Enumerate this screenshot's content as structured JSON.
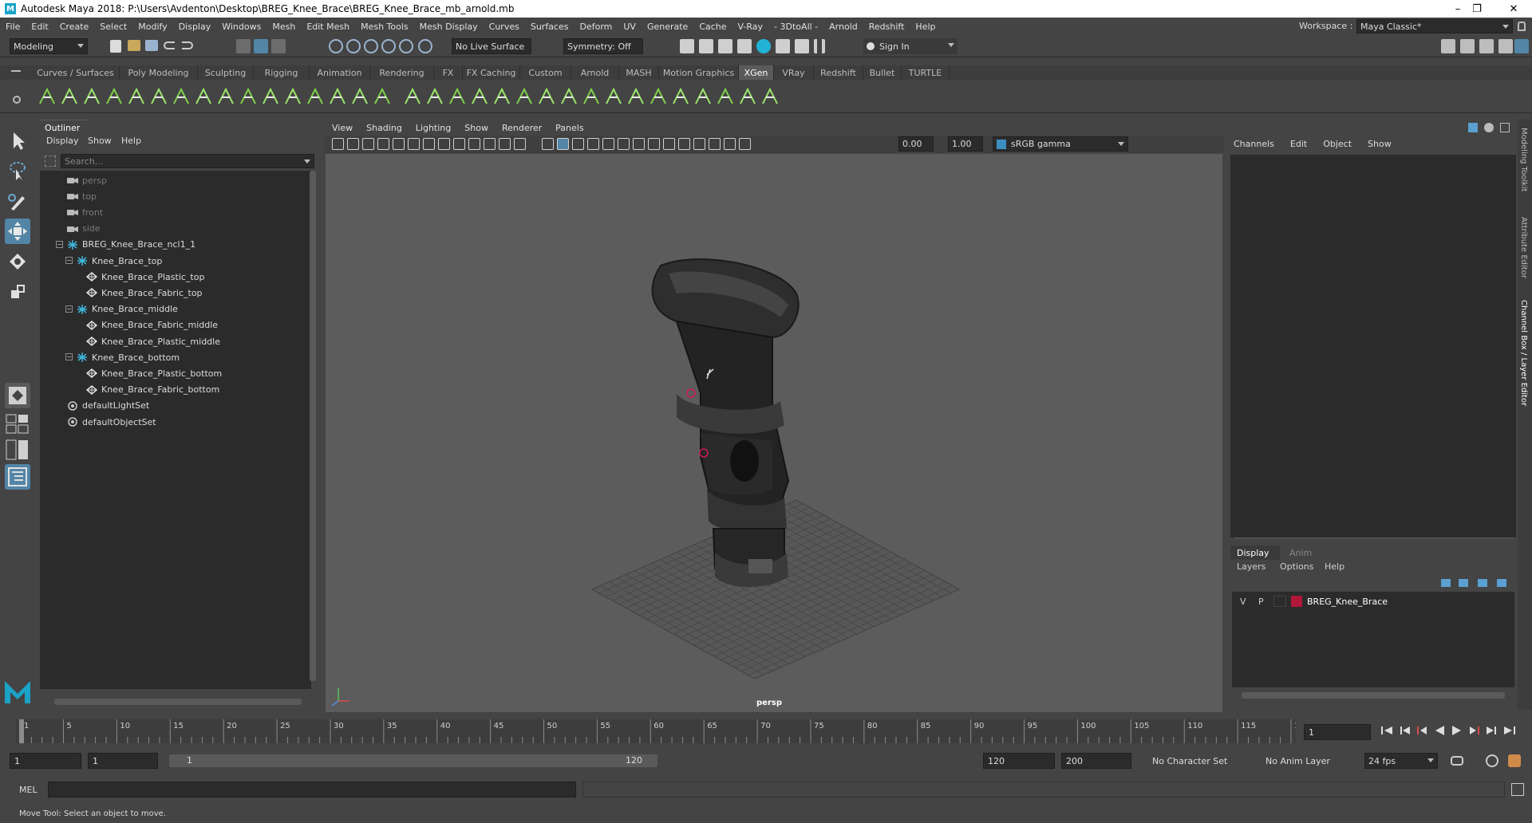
{
  "window": {
    "title": "Autodesk Maya 2018: P:\\Users\\Avdenton\\Desktop\\BREG_Knee_Brace\\BREG_Knee_Brace_mb_arnold.mb",
    "minimize": "–",
    "maximize": "❐",
    "close": "✕"
  },
  "menubar": {
    "items": [
      "File",
      "Edit",
      "Create",
      "Select",
      "Modify",
      "Display",
      "Windows",
      "Mesh",
      "Edit Mesh",
      "Mesh Tools",
      "Mesh Display",
      "Curves",
      "Surfaces",
      "Deform",
      "UV",
      "Generate",
      "Cache",
      "V-Ray",
      "- 3DtoAll -",
      "Arnold",
      "Redshift",
      "Help"
    ],
    "workspace_label": "Workspace :",
    "workspace_value": "Maya Classic*"
  },
  "statusline": {
    "mode": "Modeling",
    "live_surface": "No Live Surface",
    "symmetry": "Symmetry: Off",
    "sign_in": "Sign In"
  },
  "shelf": {
    "tabs": [
      "Curves / Surfaces",
      "Poly Modeling",
      "Sculpting",
      "Rigging",
      "Animation",
      "Rendering",
      "FX",
      "FX Caching",
      "Custom",
      "Arnold",
      "MASH",
      "Motion Graphics",
      "XGen",
      "VRay",
      "Redshift",
      "Bullet",
      "TURTLE"
    ],
    "active_tab": "XGen"
  },
  "outliner": {
    "title": "Outliner",
    "menu": [
      "Display",
      "Show",
      "Help"
    ],
    "search_placeholder": "Search...",
    "rows": [
      {
        "label": "persp",
        "indent": 0,
        "icon": "camera-icon",
        "dim": true
      },
      {
        "label": "top",
        "indent": 0,
        "icon": "camera-icon",
        "dim": true
      },
      {
        "label": "front",
        "indent": 0,
        "icon": "camera-icon",
        "dim": true
      },
      {
        "label": "side",
        "indent": 0,
        "icon": "camera-icon",
        "dim": true
      },
      {
        "label": "BREG_Knee_Brace_ncl1_1",
        "indent": 0,
        "icon": "group-icon",
        "expander": "−"
      },
      {
        "label": "Knee_Brace_top",
        "indent": 1,
        "icon": "group-icon",
        "expander": "−"
      },
      {
        "label": "Knee_Brace_Plastic_top",
        "indent": 2,
        "icon": "mesh-icon"
      },
      {
        "label": "Knee_Brace_Fabric_top",
        "indent": 2,
        "icon": "mesh-icon"
      },
      {
        "label": "Knee_Brace_middle",
        "indent": 1,
        "icon": "group-icon",
        "expander": "−"
      },
      {
        "label": "Knee_Brace_Fabric_middle",
        "indent": 2,
        "icon": "mesh-icon"
      },
      {
        "label": "Knee_Brace_Plastic_middle",
        "indent": 2,
        "icon": "mesh-icon"
      },
      {
        "label": "Knee_Brace_bottom",
        "indent": 1,
        "icon": "group-icon",
        "expander": "−"
      },
      {
        "label": "Knee_Brace_Plastic_bottom",
        "indent": 2,
        "icon": "mesh-icon"
      },
      {
        "label": "Knee_Brace_Fabric_bottom",
        "indent": 2,
        "icon": "mesh-icon"
      },
      {
        "label": "defaultLightSet",
        "indent": 0,
        "icon": "set-icon"
      },
      {
        "label": "defaultObjectSet",
        "indent": 0,
        "icon": "set-icon"
      }
    ]
  },
  "viewport": {
    "menu": [
      "View",
      "Shading",
      "Lighting",
      "Show",
      "Renderer",
      "Panels"
    ],
    "exposure": "0.00",
    "gamma": "1.00",
    "color_space": "sRGB gamma",
    "camera_label": "persp"
  },
  "channelbox": {
    "menu": [
      "Channels",
      "Edit",
      "Object",
      "Show"
    ],
    "side_tabs": [
      "Modeling Toolkit",
      "Attribute Editor",
      "Channel Box / Layer Editor"
    ]
  },
  "layers": {
    "tabs": [
      "Display",
      "Anim"
    ],
    "active_tab": "Display",
    "menu": [
      "Layers",
      "Options",
      "Help"
    ],
    "rows": [
      {
        "v": "V",
        "p": "P",
        "name": "BREG_Knee_Brace",
        "color": "#b0173a"
      }
    ]
  },
  "timeline": {
    "ticks": [
      "1",
      "5",
      "10",
      "15",
      "20",
      "25",
      "30",
      "35",
      "40",
      "45",
      "50",
      "55",
      "60",
      "65",
      "70",
      "75",
      "80",
      "85",
      "90",
      "95",
      "100",
      "105",
      "110",
      "115",
      "120"
    ],
    "current_frame": "1",
    "range_start": "1",
    "range_start_inner": "1",
    "range_slider_start": "1",
    "range_slider_end": "120",
    "range_end_inner": "120",
    "range_end": "200",
    "character_set": "No Character Set",
    "anim_layer": "No Anim Layer",
    "fps": "24 fps"
  },
  "command": {
    "label": "MEL"
  },
  "help": {
    "text": "Move Tool: Select an object to move."
  },
  "colors": {
    "accent": "#5285a6",
    "shelf_green": "#7ed04b",
    "layer_color": "#b0173a"
  }
}
